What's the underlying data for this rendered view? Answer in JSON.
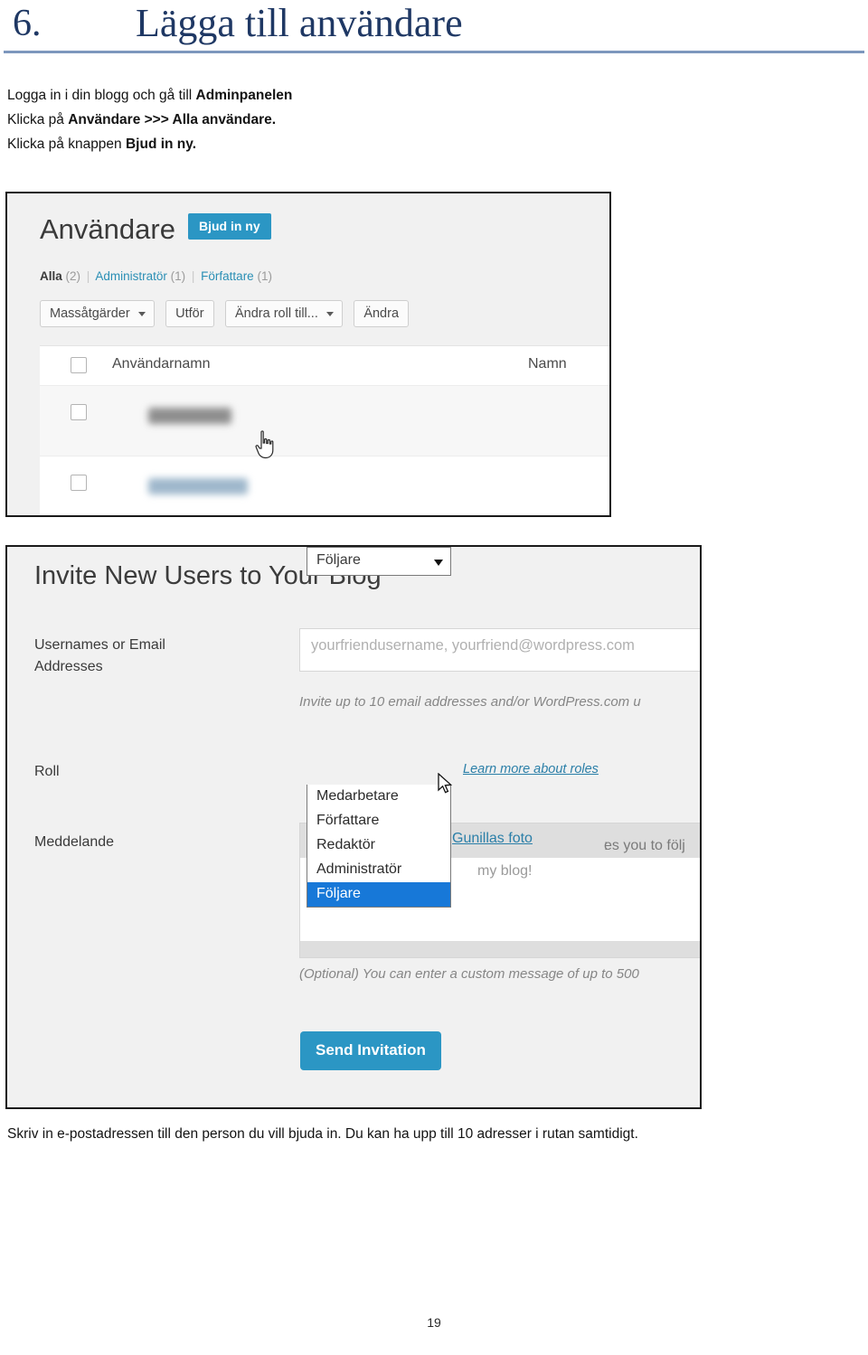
{
  "heading": {
    "number": "6.",
    "title": "Lägga till användare"
  },
  "intro": {
    "line1_a": "Logga in i din blogg och gå till ",
    "line1_b": "Adminpanelen",
    "line2_a": "Klicka på ",
    "line2_b": "Användare >>> Alla användare.",
    "line3_a": "Klicka på knappen ",
    "line3_b": "Bjud in ny."
  },
  "users_screen": {
    "title": "Användare",
    "invite_button": "Bjud in ny",
    "filters": {
      "all_label": "Alla",
      "all_count": "(2)",
      "admin_label": "Administratör",
      "admin_count": "(1)",
      "author_label": "Författare",
      "author_count": "(1)",
      "separator": "|"
    },
    "toolbar": {
      "bulk_actions": "Massåtgärder",
      "apply": "Utför",
      "change_role": "Ändra roll till...",
      "change": "Ändra"
    },
    "table": {
      "col_username": "Användarnamn",
      "col_name": "Namn",
      "rows": [
        {
          "username": "",
          "name": ""
        },
        {
          "username": "",
          "name": ""
        }
      ]
    }
  },
  "invite_screen": {
    "title": "Invite New Users to Your Blog",
    "usernames_label_line1": "Usernames or Email",
    "usernames_label_line2": "Addresses",
    "usernames_placeholder": "yourfriendusername, yourfriend@wordpress.com",
    "usernames_hint": "Invite up to 10 email addresses and/or WordPress.com u",
    "role_label": "Roll",
    "role_value": "Följare",
    "role_options": [
      "Medarbetare",
      "Författare",
      "Redaktör",
      "Administratör",
      "Följare"
    ],
    "role_selected_option": "Följare",
    "learn_more_link": "Learn more about roles",
    "message_label": "Meddelande",
    "message_preview_head_a": "es you to följ ",
    "message_preview_head_link": "Gunillas foto",
    "message_preview_head_b": ":",
    "message_preview_body": "my blog!",
    "message_hint": "(Optional) You can enter a custom message of up to 500",
    "send_button": "Send Invitation"
  },
  "outro": {
    "text": "Skriv in e-postadressen till den person du vill bjuda in. Du kan ha upp till 10 adresser i rutan samtidigt."
  },
  "footer": {
    "page_number": "19"
  },
  "colors": {
    "heading": "#1f3864",
    "rule": "#7d97bd",
    "accent_button": "#2b96c4",
    "menu_highlight": "#1778d8",
    "link": "#2b7fa8"
  }
}
